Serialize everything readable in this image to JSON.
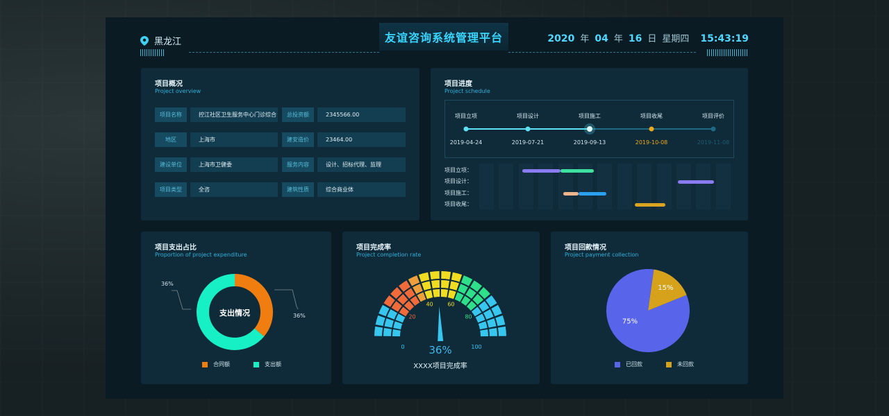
{
  "header": {
    "location": "黑龙江",
    "title": "友谊咨询系统管理平台",
    "year": "2020",
    "year_unit": "年",
    "month": "04",
    "month_unit": "年",
    "day": "16",
    "day_unit": "日",
    "weekday": "星期四",
    "time": "15:43:19"
  },
  "overview": {
    "title": "项目概况",
    "subtitle": "Project overview",
    "rows": [
      {
        "label1": "项目名称",
        "value1": "控江社区卫生服务中心门诊综合",
        "label2": "总投资额",
        "value2": "2345566.00"
      },
      {
        "label1": "地区",
        "value1": "上海市",
        "label2": "建安造价",
        "value2": "23464.00"
      },
      {
        "label1": "建设单位",
        "value1": "上海市卫健委",
        "label2": "服务内容",
        "value2": "设计、招标代理、监理"
      },
      {
        "label1": "项目类型",
        "value1": "全咨",
        "label2": "建筑性质",
        "value2": "综合商业体"
      }
    ]
  },
  "schedule": {
    "title": "项目进度",
    "subtitle": "Project schedule",
    "stages": [
      {
        "name": "项目立项",
        "date": "2019-04-24",
        "status": "done"
      },
      {
        "name": "项目设计",
        "date": "2019-07-21",
        "status": "done"
      },
      {
        "name": "项目施工",
        "date": "2019-09-13",
        "status": "current"
      },
      {
        "name": "项目收尾",
        "date": "2019-10-08",
        "status": "warning"
      },
      {
        "name": "项目评价",
        "date": "2019-11-08",
        "status": "pending"
      }
    ],
    "gantt_rows": [
      {
        "label": "项目立项：",
        "bars": [
          {
            "start": 0.17,
            "end": 0.32,
            "color": "#8a7cf0"
          },
          {
            "start": 0.32,
            "end": 0.45,
            "color": "#3ee0a0"
          }
        ]
      },
      {
        "label": "项目设计：",
        "bars": [
          {
            "start": 0.78,
            "end": 0.92,
            "color": "#8a7cf0"
          }
        ]
      },
      {
        "label": "项目施工：",
        "bars": [
          {
            "start": 0.33,
            "end": 0.39,
            "color": "#f0b48a"
          },
          {
            "start": 0.39,
            "end": 0.5,
            "color": "#2b9ff0"
          }
        ]
      },
      {
        "label": "项目收尾：",
        "bars": [
          {
            "start": 0.61,
            "end": 0.73,
            "color": "#d9a520"
          }
        ]
      }
    ]
  },
  "expenditure": {
    "title": "项目支出占比",
    "subtitle": "Proportion of project expenditure",
    "center_label": "支出情况",
    "chart_data": {
      "type": "pie",
      "series": [
        {
          "name": "合同额",
          "value": 36,
          "color": "#f07d10"
        },
        {
          "name": "支出额",
          "value": 64,
          "color": "#17f0c4"
        }
      ],
      "labels": [
        "36%",
        "36%"
      ]
    }
  },
  "completion": {
    "title": "项目完成率",
    "subtitle": "Project completion rate",
    "value_label": "36%",
    "caption": "XXXX项目完成率",
    "ticks": [
      "0",
      "20",
      "40",
      "60",
      "80",
      "100"
    ],
    "value": 36
  },
  "payment": {
    "title": "项目回款情况",
    "subtitle": "Project payment collection",
    "chart_data": {
      "type": "pie",
      "series": [
        {
          "name": "已回款",
          "value": 75,
          "label": "75%",
          "color": "#5865ea"
        },
        {
          "name": "未回款",
          "value": 15,
          "label": "15%",
          "color": "#d6a21c"
        }
      ]
    }
  }
}
